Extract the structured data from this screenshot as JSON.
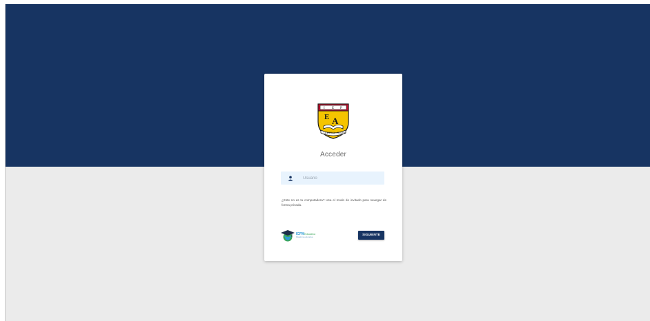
{
  "login": {
    "title": "Acceder",
    "username_placeholder": "Usuario",
    "private_note": "¿Este no es tu computadora? Usa el modo de invitado para navegar de forma privada.",
    "next_label": "SIGUIENTE"
  },
  "crest": {
    "top_letters": [
      "I",
      "E",
      "P"
    ],
    "initials_line1": "E",
    "initials_line2": "A",
    "banner_text": "LA ESPIGA - ROCHA"
  },
  "brand": {
    "name": "ICFM",
    "suffix": "Educativa",
    "tagline": "Plataforma educativa"
  },
  "colors": {
    "header_band": "#173462",
    "page_background": "#ebebeb",
    "card_background": "#ffffff",
    "input_background": "#e8f3fd",
    "button_background": "#173462",
    "crest_gold": "#f5c400",
    "crest_red": "#c8102e"
  },
  "icons": {
    "user_field_icon": "user-icon",
    "brand_icon": "graduation-cap-globe-icon"
  }
}
